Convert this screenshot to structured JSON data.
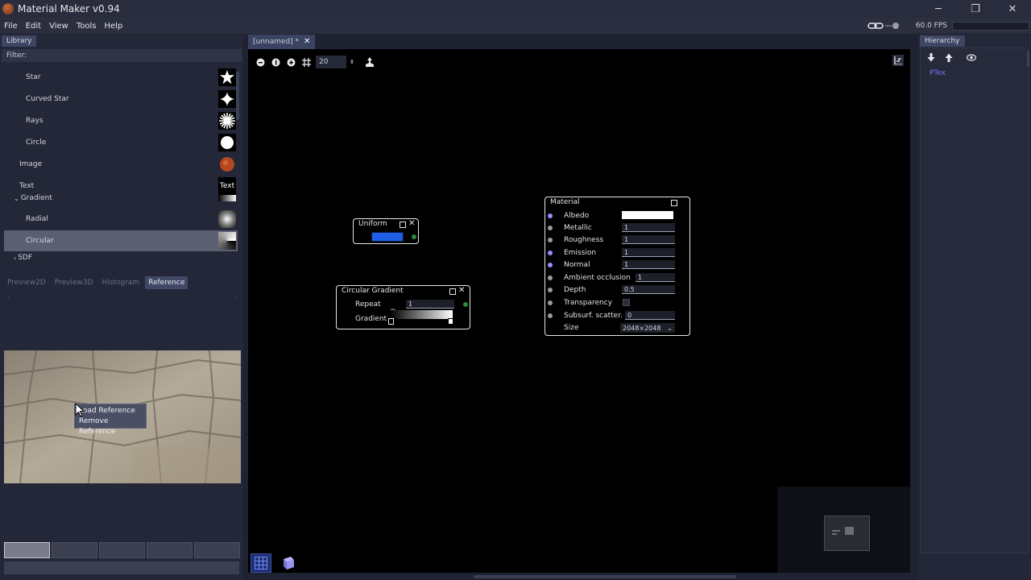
{
  "window": {
    "title": "Material Maker v0.94",
    "minimize": "─",
    "restore": "❐",
    "close": "✕"
  },
  "menu": [
    "File",
    "Edit",
    "View",
    "Tools",
    "Help"
  ],
  "status": {
    "fps": "60.0 FPS"
  },
  "library": {
    "tab": "Library",
    "filter_label": "Filter:",
    "items": [
      {
        "label": "Star",
        "thumb": "Star"
      },
      {
        "label": "Curved Star",
        "thumb": "Curved Star"
      },
      {
        "label": "Rays",
        "thumb": "Rays"
      },
      {
        "label": "Circle",
        "thumb": "Circle"
      },
      {
        "label": "Image",
        "thumb": "Image"
      },
      {
        "label": "Text",
        "thumb": "Text"
      },
      {
        "label": "Gradient",
        "thumb": "Gradient"
      },
      {
        "label": "Radial",
        "thumb": "Radial"
      },
      {
        "label": "Circular",
        "thumb": "Circular"
      },
      {
        "label": "SDF",
        "thumb": "SDF"
      }
    ],
    "expand_open": "⌄",
    "expand_closed": "›"
  },
  "preview_tabs": [
    "Preview2D",
    "Preview3D",
    "Histogram",
    "Reference"
  ],
  "active_preview_tab": "Reference",
  "context_menu": [
    "Load Reference",
    "Remove Reference"
  ],
  "document_tab": {
    "label": "[unnamed] *",
    "close": "✕"
  },
  "graph_toolbar": {
    "zoom_value": "20"
  },
  "nodes": {
    "uniform": {
      "title": "Uniform",
      "color": "#1f5fe6"
    },
    "circular_gradient": {
      "title": "Circular Gradient",
      "repeat_label": "Repeat",
      "repeat_value": "1",
      "gradient_label": "Gradient"
    },
    "material": {
      "title": "Material",
      "rows": [
        {
          "label": "Albedo",
          "value": ""
        },
        {
          "label": "Metallic",
          "value": "1"
        },
        {
          "label": "Roughness",
          "value": "1"
        },
        {
          "label": "Emission",
          "value": "1"
        },
        {
          "label": "Normal",
          "value": "1"
        },
        {
          "label": "Ambient occlusion",
          "value": "1"
        },
        {
          "label": "Depth",
          "value": "0.5"
        },
        {
          "label": "Transparency",
          "value": ""
        },
        {
          "label": "Subsurf. scatter.",
          "value": "0"
        },
        {
          "label": "Size",
          "value": "2048×2048"
        }
      ]
    }
  },
  "hierarchy": {
    "tab": "Hierarchy",
    "item": "PTex"
  },
  "colors": {
    "accent": "#3e4664",
    "port_purple": "#9b8cff",
    "port_grey": "#9a9aa5"
  }
}
